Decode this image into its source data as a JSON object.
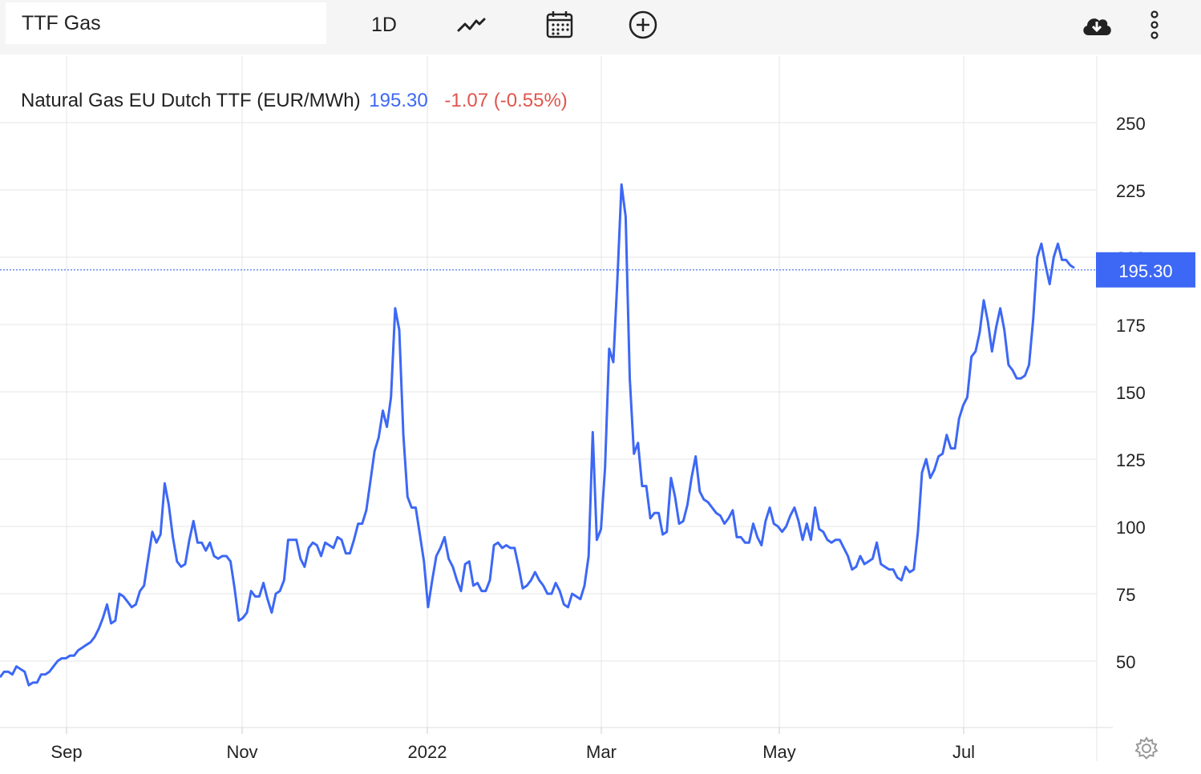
{
  "toolbar": {
    "search_value": "TTF Gas",
    "period_label": "1D",
    "icons": [
      "line-chart-icon",
      "calendar-icon",
      "add-circle-icon",
      "cloud-download-icon",
      "more-vertical-icon"
    ]
  },
  "header": {
    "instrument": "Natural Gas EU Dutch TTF (EUR/MWh)",
    "last_price": "195.30",
    "change": "-1.07 (-0.55%)"
  },
  "colors": {
    "line": "#3d68f5",
    "change_negative": "#e0554d",
    "price_tag_bg": "#3d68f5",
    "grid": "#e6e6e6"
  },
  "chart_data": {
    "type": "line",
    "title": "Natural Gas EU Dutch TTF (EUR/MWh)",
    "xlabel": "",
    "ylabel": "",
    "ylim": [
      25,
      260
    ],
    "yticks": [
      50,
      75,
      100,
      125,
      150,
      175,
      200,
      225,
      250
    ],
    "x_tick_labels": [
      "Sep",
      "Nov",
      "2022",
      "Mar",
      "May",
      "Jul"
    ],
    "last_value_label": "195.30",
    "grid": true,
    "series": [
      {
        "values": [
          44,
          46,
          46,
          45,
          48,
          47,
          46,
          41,
          42,
          42,
          45,
          45,
          46,
          48,
          50,
          51,
          51,
          52,
          52,
          54,
          55,
          56,
          57,
          59,
          62,
          66,
          71,
          64,
          65,
          75,
          74,
          72,
          70,
          71,
          76,
          78,
          88,
          98,
          94,
          97,
          116,
          108,
          96,
          87,
          85,
          86,
          95,
          102,
          94,
          94,
          91,
          94,
          89,
          88,
          89,
          89,
          87,
          77,
          65,
          66,
          68,
          76,
          74,
          74,
          79,
          73,
          68,
          75,
          76,
          80,
          95,
          95,
          95,
          88,
          85,
          92,
          94,
          93,
          89,
          94,
          93,
          92,
          96,
          95,
          90,
          90,
          95,
          101,
          101,
          106,
          117,
          128,
          133,
          143,
          137,
          148,
          181,
          173,
          134,
          111,
          107,
          107,
          97,
          87,
          70,
          80,
          89,
          92,
          96,
          88,
          85,
          80,
          76,
          86,
          87,
          78,
          79,
          76,
          76,
          80,
          93,
          94,
          92,
          93,
          92,
          92,
          85,
          77,
          78,
          80,
          83,
          80,
          78,
          75,
          75,
          79,
          76,
          71,
          70,
          75,
          74,
          73,
          78,
          89,
          135,
          95,
          99,
          122,
          166,
          161,
          192,
          227,
          215,
          155,
          127,
          131,
          115,
          115,
          103,
          105,
          105,
          97,
          98,
          118,
          111,
          101,
          102,
          108,
          118,
          126,
          113,
          110,
          109,
          107,
          105,
          104,
          101,
          103,
          106,
          96,
          96,
          94,
          94,
          101,
          96,
          93,
          102,
          107,
          101,
          100,
          98,
          100,
          104,
          107,
          102,
          95,
          101,
          95,
          107,
          99,
          98,
          95,
          94,
          95,
          95,
          92,
          89,
          84,
          85,
          89,
          86,
          87,
          88,
          94,
          86,
          85,
          84,
          84,
          81,
          80,
          85,
          83,
          84,
          98,
          120,
          125,
          118,
          121,
          126,
          127,
          134,
          129,
          129,
          140,
          145,
          148,
          163,
          165,
          172,
          184,
          176,
          165,
          174,
          181,
          173,
          160,
          158,
          155,
          155,
          156,
          160,
          177,
          200,
          205,
          197,
          190,
          200,
          205,
          199,
          199,
          197,
          196
        ]
      }
    ]
  }
}
